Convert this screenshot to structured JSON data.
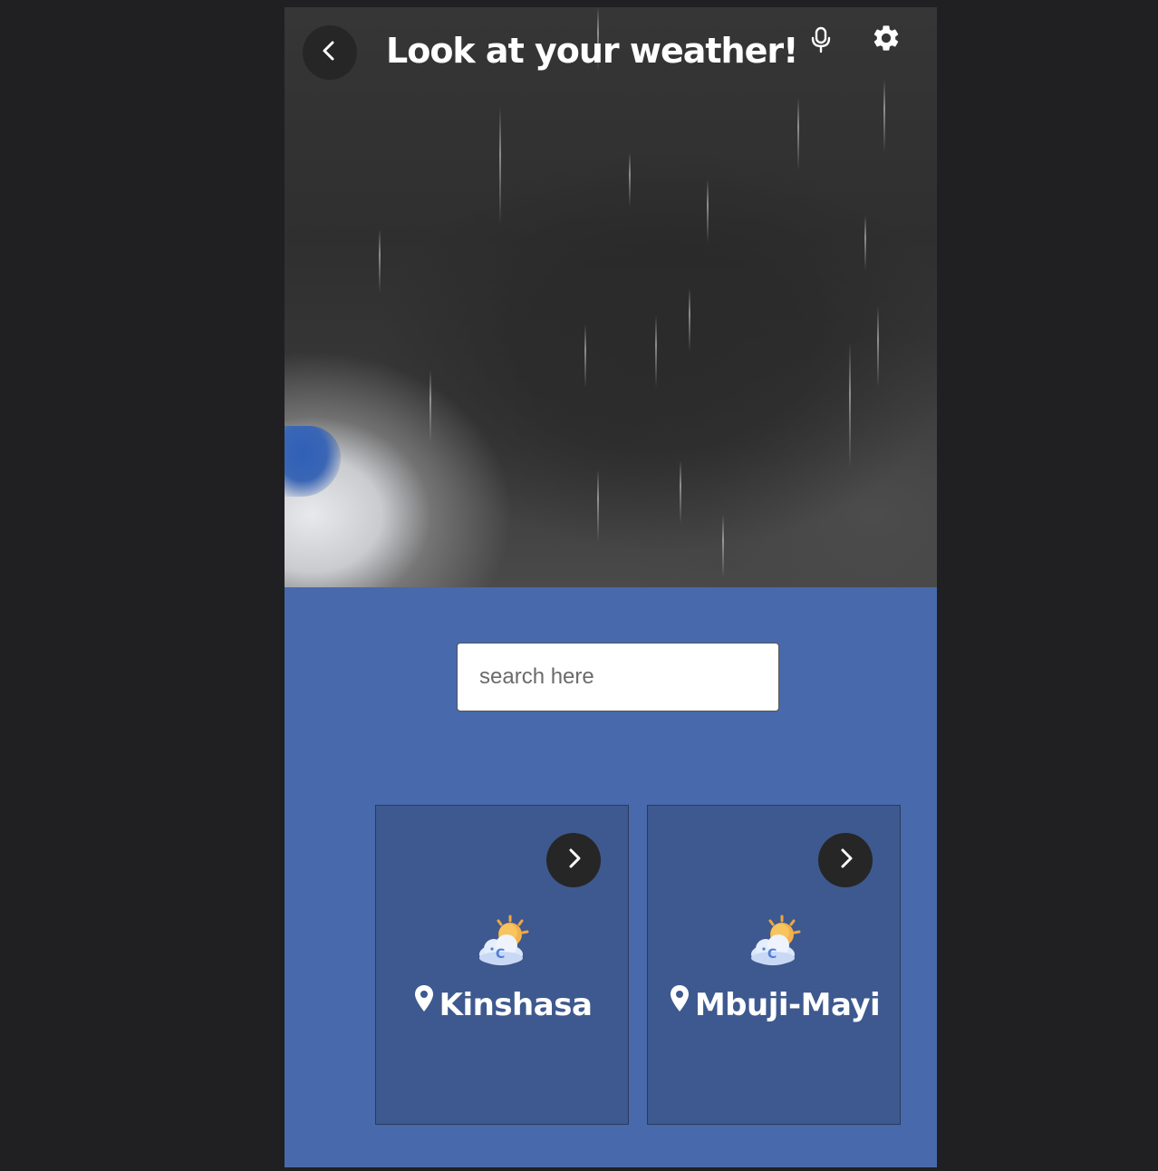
{
  "header": {
    "title": "Look at your weather!",
    "back_icon": "chevron-left-icon",
    "mic_icon": "microphone-icon",
    "settings_icon": "gear-icon"
  },
  "hero": {
    "scene": "rainy-storm-clouds"
  },
  "search": {
    "placeholder": "search here",
    "value": ""
  },
  "cities": [
    {
      "name": "Kinshasa",
      "weather_icon": "partly-cloudy-sun-icon",
      "pin_icon": "location-pin-icon",
      "arrow_icon": "chevron-right-icon"
    },
    {
      "name": "Mbuji-Mayi",
      "weather_icon": "partly-cloudy-sun-icon",
      "pin_icon": "location-pin-icon",
      "arrow_icon": "chevron-right-icon"
    }
  ],
  "colors": {
    "page_bg": "#202022",
    "panel_bg": "#4869ab",
    "card_bg": "#3d598f",
    "button_bg": "#262626",
    "text": "#ffffff"
  }
}
